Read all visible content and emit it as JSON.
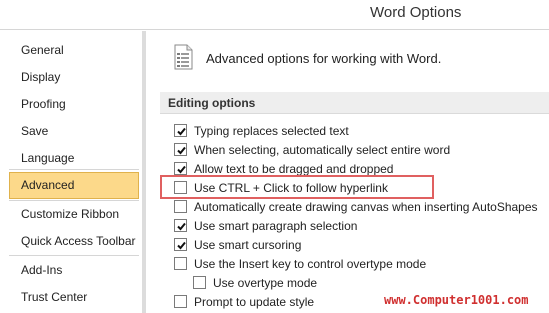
{
  "window": {
    "title": "Word Options"
  },
  "sidebar": {
    "items": [
      {
        "label": "General"
      },
      {
        "label": "Display"
      },
      {
        "label": "Proofing"
      },
      {
        "label": "Save"
      },
      {
        "label": "Language"
      },
      {
        "label": "Advanced",
        "selected": true
      },
      {
        "label": "Customize Ribbon"
      },
      {
        "label": "Quick Access Toolbar"
      },
      {
        "label": "Add-Ins"
      },
      {
        "label": "Trust Center"
      }
    ]
  },
  "main": {
    "header": {
      "icon": "options-document-icon",
      "text": "Advanced options for working with Word."
    },
    "section": {
      "title": "Editing options",
      "options": [
        {
          "label": "Typing replaces selected text",
          "checked": true
        },
        {
          "label": "When selecting, automatically select entire word",
          "checked": true
        },
        {
          "label": "Allow text to be dragged and dropped",
          "checked": true
        },
        {
          "label": "Use CTRL + Click to follow hyperlink",
          "checked": false,
          "highlighted": true
        },
        {
          "label": "Automatically create drawing canvas when inserting AutoShapes",
          "checked": false
        },
        {
          "label": "Use smart paragraph selection",
          "checked": true
        },
        {
          "label": "Use smart cursoring",
          "checked": true
        },
        {
          "label": "Use the Insert key to control overtype mode",
          "checked": false
        },
        {
          "label": "Use overtype mode",
          "checked": false
        },
        {
          "label": "Prompt to update style",
          "checked": false
        }
      ]
    }
  },
  "watermark": {
    "text": "www.Computer1001.com"
  },
  "colors": {
    "selected_bg": "#fcd98a",
    "selected_border": "#e0b24c",
    "highlight_border": "#e06060",
    "watermark": "#d03030"
  }
}
